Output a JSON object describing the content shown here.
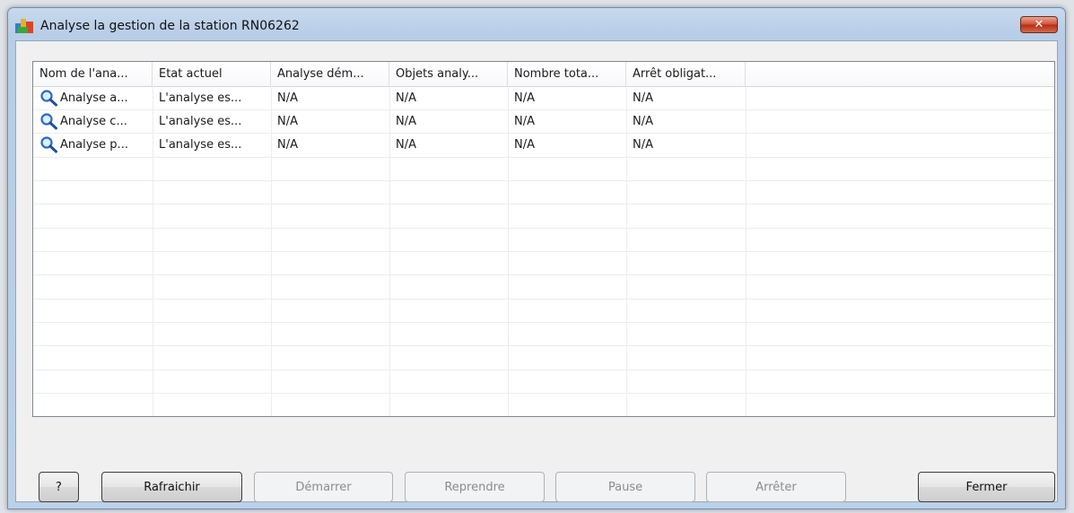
{
  "window": {
    "title": "Analyse la gestion de la station RN06262",
    "close_label": "✕"
  },
  "table": {
    "columns": [
      "Nom de l'ana...",
      "Etat actuel",
      "Analyse dém...",
      "Objets analy...",
      "Nombre tota...",
      "Arrêt obligat..."
    ],
    "rows": [
      [
        "Analyse a...",
        "L'analyse es...",
        "N/A",
        "N/A",
        "N/A",
        "N/A"
      ],
      [
        "Analyse c...",
        "L'analyse es...",
        "N/A",
        "N/A",
        "N/A",
        "N/A"
      ],
      [
        "Analyse p...",
        "L'analyse es...",
        "N/A",
        "N/A",
        "N/A",
        "N/A"
      ]
    ],
    "row_icon": "magnifier-icon"
  },
  "buttons": {
    "help": "?",
    "refresh": "Rafraichir",
    "start": "Démarrer",
    "resume": "Reprendre",
    "pause": "Pause",
    "stop": "Arrêter",
    "close": "Fermer"
  }
}
